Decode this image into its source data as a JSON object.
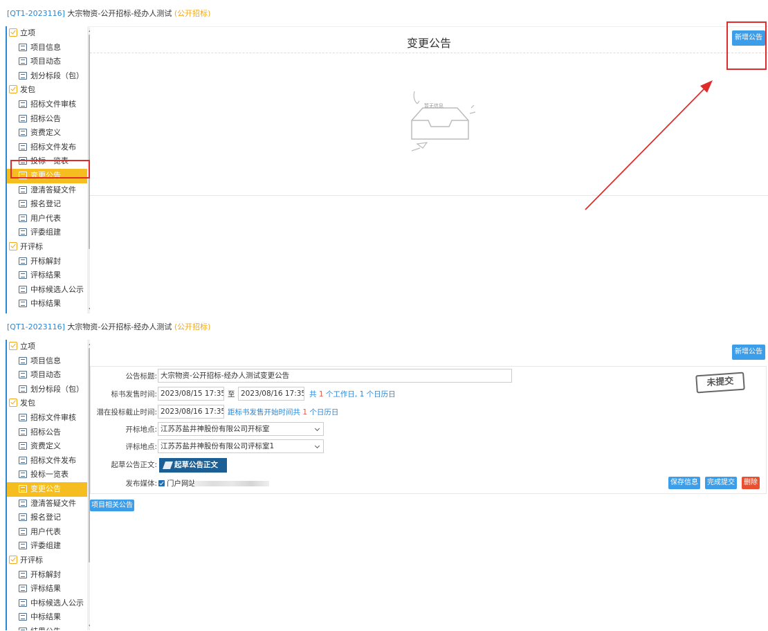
{
  "header": {
    "code": "[QT1-2023116]",
    "title": "大宗物资-公开招标-经办人测试",
    "type": "(公开招标)"
  },
  "sidebar": {
    "groups": [
      {
        "label": "立项",
        "items": [
          "项目信息",
          "项目动态",
          "划分标段（包）"
        ]
      },
      {
        "label": "发包",
        "items": [
          "招标文件审核",
          "招标公告",
          "资费定义",
          "招标文件发布",
          "投标一览表",
          "变更公告",
          "澄清答疑文件",
          "报名登记",
          "用户代表",
          "评委组建"
        ]
      },
      {
        "label": "开评标",
        "items": [
          "开标解封",
          "评标结果",
          "中标候选人公示",
          "中标结果",
          "结果公告"
        ]
      }
    ],
    "active_item": "变更公告"
  },
  "top_panel": {
    "page_title": "变更公告",
    "add_button": "新增公告",
    "empty_text": "暂无信息"
  },
  "bottom_panel": {
    "add_button": "新增公告",
    "form": {
      "title_label": "公告标题:",
      "title_value": "大宗物资-公开招标-经办人测试变更公告",
      "sale_label": "标书发售时间:",
      "sale_start": "2023/08/15 17:35",
      "sale_to": "至",
      "sale_end": "2023/08/16 17:35",
      "sale_info": {
        "prefix": "共",
        "workdays": "1",
        "workdays_unit": "个工作日,",
        "caldays": "1",
        "caldays_unit": "个日历日"
      },
      "deadline_label": "潜在投标截止时间:",
      "deadline_value": "2023/08/16 17:35",
      "deadline_info": {
        "prefix": "距标书发售开始时间共",
        "days": "1",
        "unit": "个日历日"
      },
      "open_label": "开标地点:",
      "open_value": "江苏苏盐井神股份有限公司开标室",
      "eval_label": "评标地点:",
      "eval_value": "江苏苏盐井神股份有限公司评标室1",
      "draft_label": "起草公告正文:",
      "draft_button": "起草公告正文",
      "media_label": "发布媒体:",
      "media_option": "门户网站",
      "status_stamp": "未提交",
      "save_button": "保存信息",
      "submit_button": "完成提交",
      "delete_button": "删除"
    },
    "related_button": "项目相关公告"
  }
}
